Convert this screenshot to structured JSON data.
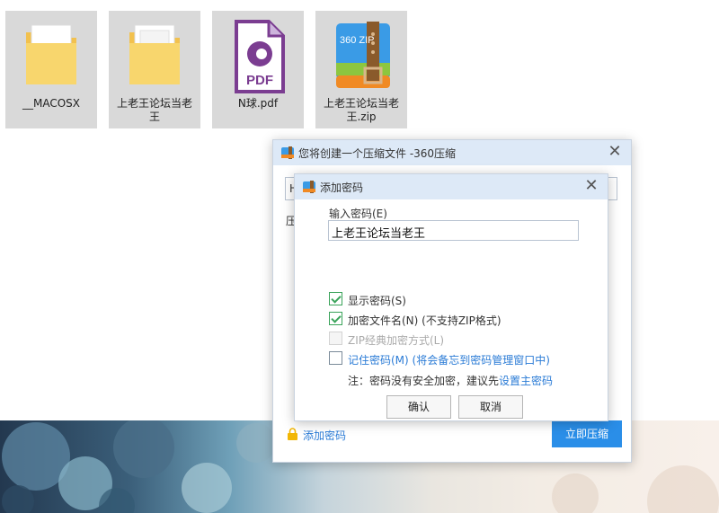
{
  "desktop": {
    "icons": [
      {
        "label": "__MACOSX",
        "icon": "folder-icon"
      },
      {
        "label": "上老王论坛当老王",
        "icon": "folder-icon"
      },
      {
        "label": "N球.pdf",
        "icon": "pdf-file-icon",
        "badge": "PDF"
      },
      {
        "label": "上老王论坛当老王.zip",
        "icon": "360zip-archive-icon",
        "badge": "360 ZIP"
      }
    ]
  },
  "main_dialog": {
    "title": "您将创建一个压缩文件 -360压缩",
    "path_prefix": "H",
    "compress_prefix": "压",
    "add_password_link": "添加密码",
    "compress_button": "立即压缩"
  },
  "password_dialog": {
    "title": "添加密码",
    "input_label": "输入密码(E)",
    "password_value": "上老王论坛当老王",
    "options": {
      "show_password": {
        "label": "显示密码(S)",
        "checked": true
      },
      "encrypt_filenames": {
        "label": "加密文件名(N) (不支持ZIP格式)",
        "checked": true
      },
      "zip_classic": {
        "label": "ZIP经典加密方式(L)",
        "checked": false,
        "disabled": true
      },
      "remember_password": {
        "label": "记住密码(M) (将会备忘到密码管理窗口中)",
        "checked": false
      }
    },
    "note_text": "注：密码没有安全加密，建议先",
    "note_link": "设置主密码",
    "confirm_button": "确认",
    "cancel_button": "取消"
  },
  "colors": {
    "accent": "#2a8ee8",
    "check": "#3aa35a",
    "link": "#2a7bd6",
    "titlebar": "#dde9f7"
  }
}
